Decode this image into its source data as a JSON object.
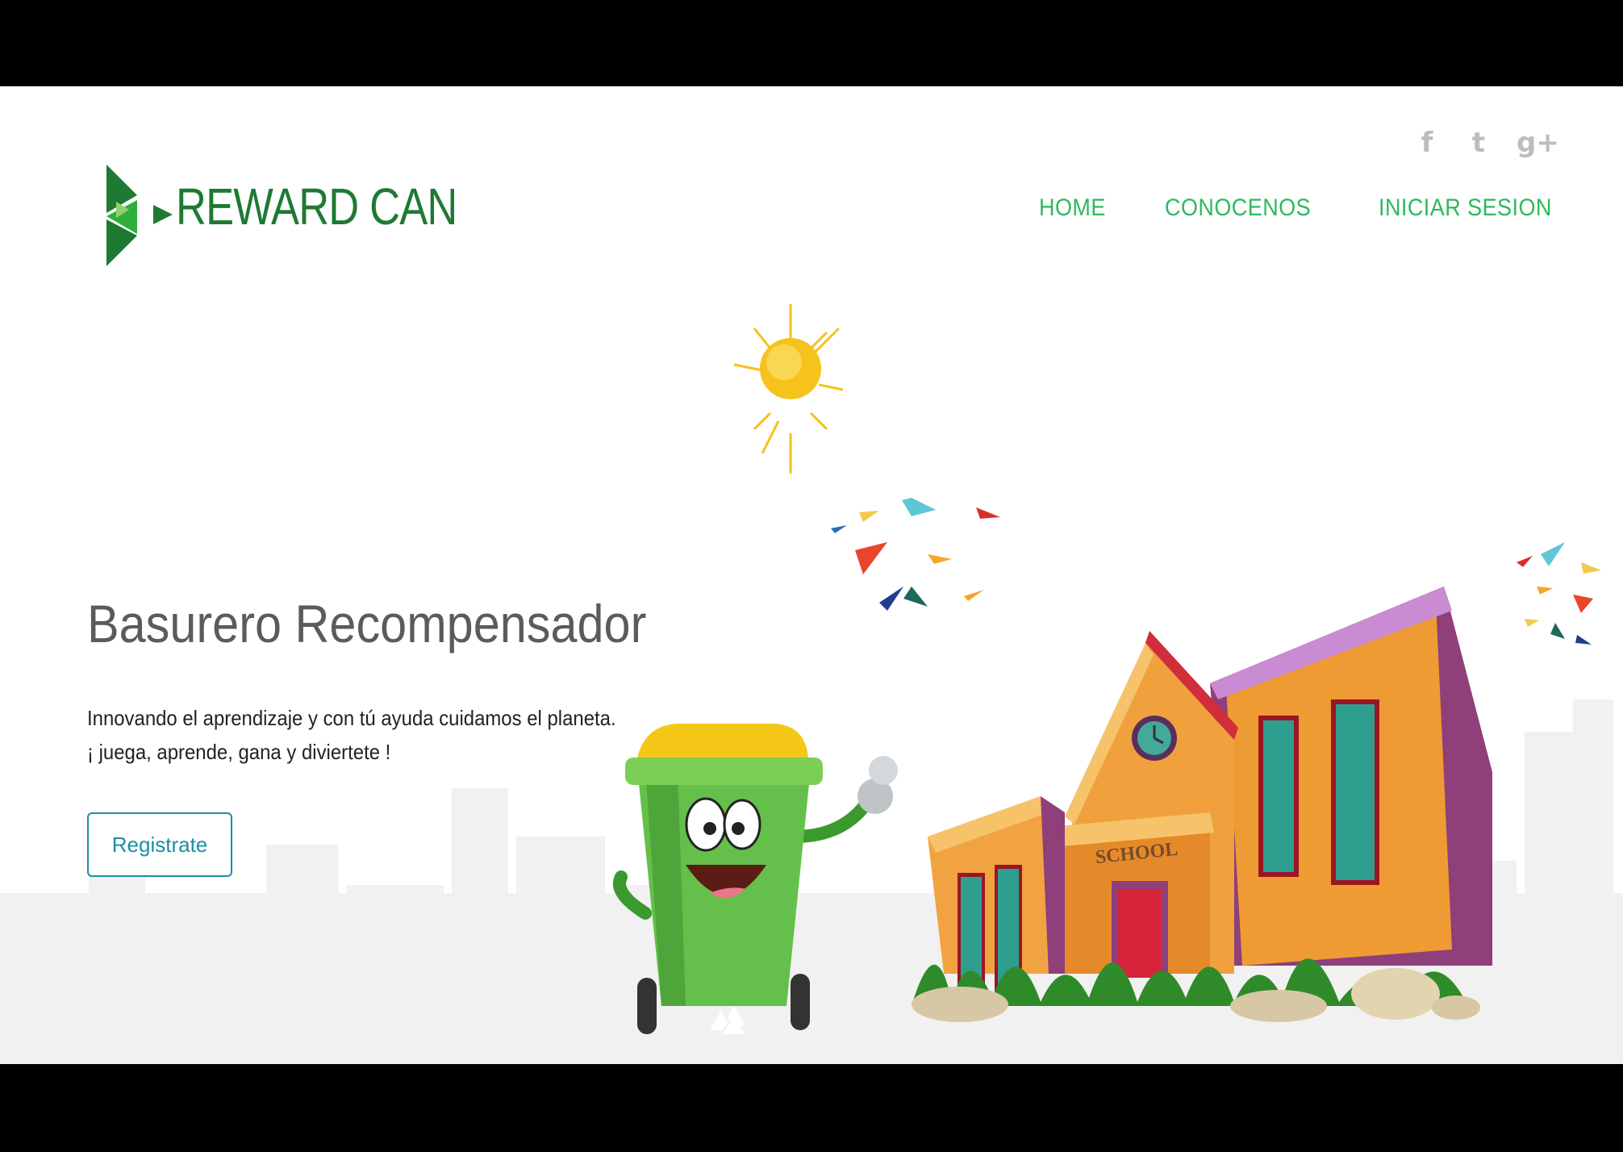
{
  "brand": {
    "name": "REWARD CAN"
  },
  "social": [
    {
      "icon": "facebook-icon",
      "glyph": "f"
    },
    {
      "icon": "twitter-icon",
      "glyph": "t"
    },
    {
      "icon": "google-plus-icon",
      "glyph": "g+"
    }
  ],
  "nav": {
    "items": [
      {
        "label": "HOME"
      },
      {
        "label": "CONOCENOS"
      },
      {
        "label": "INICIAR SESION"
      }
    ]
  },
  "hero": {
    "title": "Basurero Recompensador",
    "line1": "Innovando el aprendizaje y con tú ayuda cuidamos el planeta.",
    "line2": "¡ juega, aprende, gana y diviertete !",
    "cta": "Registrate"
  },
  "illustration": {
    "school_sign": "SCHOOL"
  },
  "colors": {
    "nav": "#2eb85c",
    "brand_dark": "#1e7a33",
    "brand_light": "#2fae3c",
    "cta_border": "#1a8fa3",
    "title": "#5b5b5b"
  }
}
